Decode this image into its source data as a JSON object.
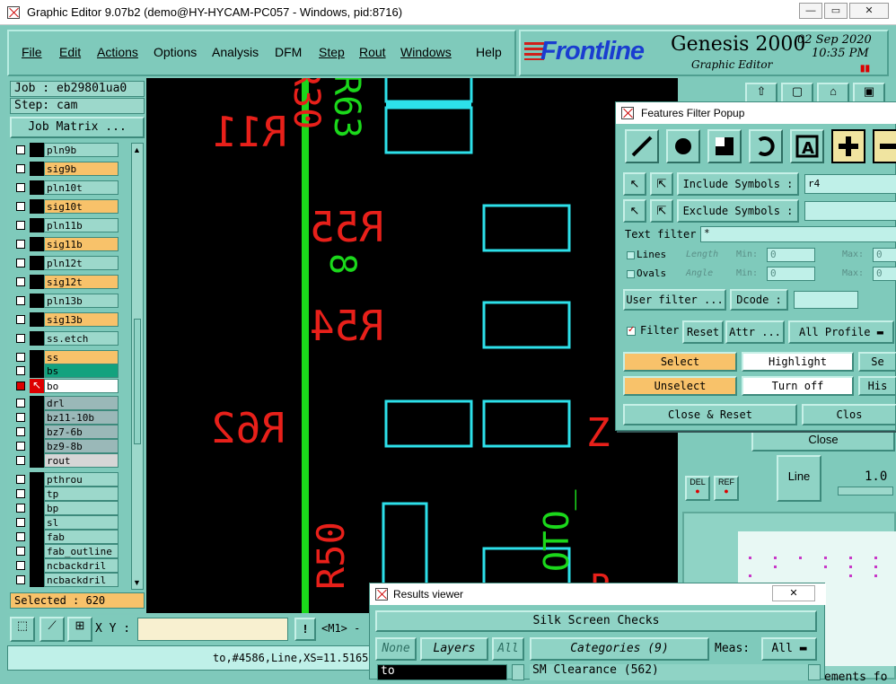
{
  "window": {
    "title": "Graphic Editor 9.07b2 (demo@HY-HYCAM-PC057 - Windows, pid:8716)"
  },
  "menu": [
    "File",
    "Edit",
    "Actions",
    "Options",
    "Analysis",
    "DFM",
    "Step",
    "Rout",
    "Windows",
    "Help"
  ],
  "brand": {
    "logo": "Frontline",
    "product": "Genesis 2000",
    "subtitle": "Graphic Editor",
    "date": "02 Sep 2020",
    "time": "10:35 PM"
  },
  "job": {
    "job": "Job : eb29801ua0",
    "step": "Step: cam",
    "matrix_button": "Job Matrix ..."
  },
  "layers": [
    {
      "name": "pln9b",
      "color": "#9cd8cb"
    },
    {
      "name": "sig9b",
      "color": "#f8c26a"
    },
    {
      "name": "pln10t",
      "color": "#9cd8cb"
    },
    {
      "name": "sig10t",
      "color": "#f8c26a"
    },
    {
      "name": "pln11b",
      "color": "#9cd8cb"
    },
    {
      "name": "sig11b",
      "color": "#f8c26a"
    },
    {
      "name": "pln12t",
      "color": "#9cd8cb"
    },
    {
      "name": "sig12t",
      "color": "#f8c26a"
    },
    {
      "name": "pln13b",
      "color": "#9cd8cb"
    },
    {
      "name": "sig13b",
      "color": "#f8c26a"
    },
    {
      "name": "ss.etch",
      "color": "#9cd8cb"
    },
    {
      "name": "ss",
      "color": "#f8c26a"
    },
    {
      "name": "bs",
      "color": "#13a27e"
    },
    {
      "name": "bo",
      "color": "#ffffff"
    },
    {
      "name": "drl",
      "color": "#9ab8b8"
    },
    {
      "name": "bz11-10b",
      "color": "#9ab8b8"
    },
    {
      "name": "bz7-6b",
      "color": "#9ab8b8"
    },
    {
      "name": "bz9-8b",
      "color": "#9ab8b8"
    },
    {
      "name": "rout",
      "color": "#d6d6d6"
    },
    {
      "name": "pthrou",
      "color": "#9cd8cb"
    },
    {
      "name": "tp",
      "color": "#9cd8cb"
    },
    {
      "name": "bp",
      "color": "#9cd8cb"
    },
    {
      "name": "sl",
      "color": "#9cd8cb"
    },
    {
      "name": "fab",
      "color": "#9cd8cb"
    },
    {
      "name": "fab_outline",
      "color": "#9cd8cb"
    },
    {
      "name": "ncbackdril",
      "color": "#9cd8cb"
    },
    {
      "name": "ncbackdril",
      "color": "#9cd8cb"
    }
  ],
  "selected": "Selected : 620",
  "bottom": {
    "xy_label": "X Y :",
    "mouse": "<M1> -",
    "status": "to,#4586,Line,XS=11.5165"
  },
  "canvas_labels": [
    "R11",
    "R55",
    "R54",
    "R62",
    "R30",
    "R63",
    "R50"
  ],
  "features_filter": {
    "title": "Features Filter Popup",
    "include_label": "Include Symbols :",
    "include_value": "r4",
    "exclude_label": "Exclude Symbols :",
    "exclude_value": "",
    "text_filter_label": "Text filter",
    "text_filter_value": "*",
    "lines": "Lines",
    "ovals": "Ovals",
    "length": "Length",
    "angle": "Angle",
    "min": "Min:",
    "max": "Max:",
    "zero": "0",
    "user_filter": "User filter ...",
    "dcode": "Dcode :",
    "filter": "Filter",
    "reset": "Reset",
    "attr": "Attr ...",
    "profile": "All Profile",
    "select": "Select",
    "highlight": "Highlight",
    "se": "Se",
    "unselect": "Unselect",
    "turnoff": "Turn off",
    "his": "His",
    "close_reset": "Close & Reset",
    "clos": "Clos"
  },
  "right_panel": {
    "close": "Close",
    "line": "Line",
    "value": "1.0",
    "del": "DEL",
    "ref": "REF"
  },
  "results_viewer": {
    "title": "Results viewer",
    "header": "Silk Screen Checks",
    "none": "None",
    "layers": "Layers",
    "all": "All",
    "categories": "Categories (9)",
    "meas": "Meas:",
    "meas_value": "All",
    "layer_item": "to",
    "category_item": "SM Clearance (562)"
  },
  "clipped_text": "ements fo"
}
